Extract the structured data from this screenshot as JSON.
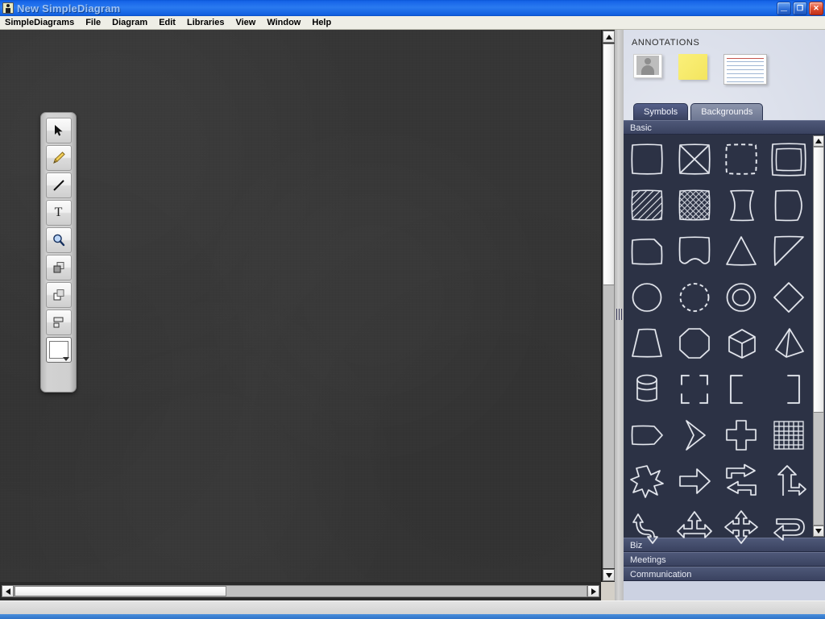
{
  "window": {
    "title": "New SimpleDiagram",
    "icon": "app-icon",
    "buttons": {
      "minimize": "_",
      "maximize": "❐",
      "close": "✕"
    }
  },
  "menubar": {
    "items": [
      {
        "label": "SimpleDiagrams"
      },
      {
        "label": "File"
      },
      {
        "label": "Diagram"
      },
      {
        "label": "Edit"
      },
      {
        "label": "Libraries"
      },
      {
        "label": "View"
      },
      {
        "label": "Window"
      },
      {
        "label": "Help"
      }
    ]
  },
  "toolbox": {
    "tools": [
      {
        "name": "select-tool",
        "icon": "pointer-icon"
      },
      {
        "name": "pencil-tool",
        "icon": "pencil-icon"
      },
      {
        "name": "line-tool",
        "icon": "line-icon"
      },
      {
        "name": "text-tool",
        "icon": "text-t-icon",
        "label": "T"
      },
      {
        "name": "zoom-tool",
        "icon": "magnifier-icon"
      },
      {
        "name": "bring-to-front-tool",
        "icon": "bring-to-front-icon"
      },
      {
        "name": "send-to-back-tool",
        "icon": "send-to-back-icon"
      },
      {
        "name": "align-tool",
        "icon": "align-icon"
      },
      {
        "name": "fill-color-tool",
        "icon": "color-swatch-icon",
        "color": "#ffffff"
      }
    ]
  },
  "canvas": {
    "background_color": "#363636",
    "vertical_scrollbar": {
      "thumb_position_pct": 0,
      "thumb_size_pct": 45
    },
    "horizontal_scrollbar": {
      "thumb_position_pct": 0,
      "thumb_size_pct": 37
    }
  },
  "panel": {
    "annotations": {
      "title": "ANNOTATIONS",
      "items": [
        {
          "name": "photo-annotation",
          "type": "photo"
        },
        {
          "name": "sticky-note-annotation",
          "type": "sticky-note",
          "color": "#f5e95f"
        },
        {
          "name": "index-card-annotation",
          "type": "index-card"
        }
      ]
    },
    "tabs": [
      {
        "label": "Symbols",
        "active": true
      },
      {
        "label": "Backgrounds",
        "active": false
      }
    ],
    "libraries": [
      {
        "label": "Basic",
        "expanded": true
      },
      {
        "label": "Biz",
        "expanded": false
      },
      {
        "label": "Meetings",
        "expanded": false
      },
      {
        "label": "Communication",
        "expanded": false
      }
    ],
    "symbols": [
      {
        "name": "square"
      },
      {
        "name": "square-with-x"
      },
      {
        "name": "dashed-square"
      },
      {
        "name": "double-square"
      },
      {
        "name": "hatched-square"
      },
      {
        "name": "cross-hatched-square"
      },
      {
        "name": "curved-left-shape"
      },
      {
        "name": "curved-right-shape"
      },
      {
        "name": "cut-corner-rectangle"
      },
      {
        "name": "banner-shape"
      },
      {
        "name": "triangle"
      },
      {
        "name": "right-triangle"
      },
      {
        "name": "circle"
      },
      {
        "name": "dashed-circle"
      },
      {
        "name": "double-circle"
      },
      {
        "name": "diamond"
      },
      {
        "name": "trapezoid"
      },
      {
        "name": "octagon"
      },
      {
        "name": "cube"
      },
      {
        "name": "pyramid"
      },
      {
        "name": "cylinder"
      },
      {
        "name": "corner-brackets"
      },
      {
        "name": "left-bracket"
      },
      {
        "name": "right-bracket"
      },
      {
        "name": "pentagon-tag"
      },
      {
        "name": "chevron"
      },
      {
        "name": "cross"
      },
      {
        "name": "grid"
      },
      {
        "name": "starburst"
      },
      {
        "name": "right-arrow"
      },
      {
        "name": "double-swap-arrow"
      },
      {
        "name": "bent-arrow"
      },
      {
        "name": "s-curve-arrow"
      },
      {
        "name": "three-way-arrow"
      },
      {
        "name": "four-way-arrow"
      },
      {
        "name": "u-turn-arrow"
      }
    ],
    "symbol_scrollbar": {
      "thumb_position_pct": 0,
      "thumb_size_pct": 68
    }
  },
  "statusbar": {
    "text": ""
  }
}
